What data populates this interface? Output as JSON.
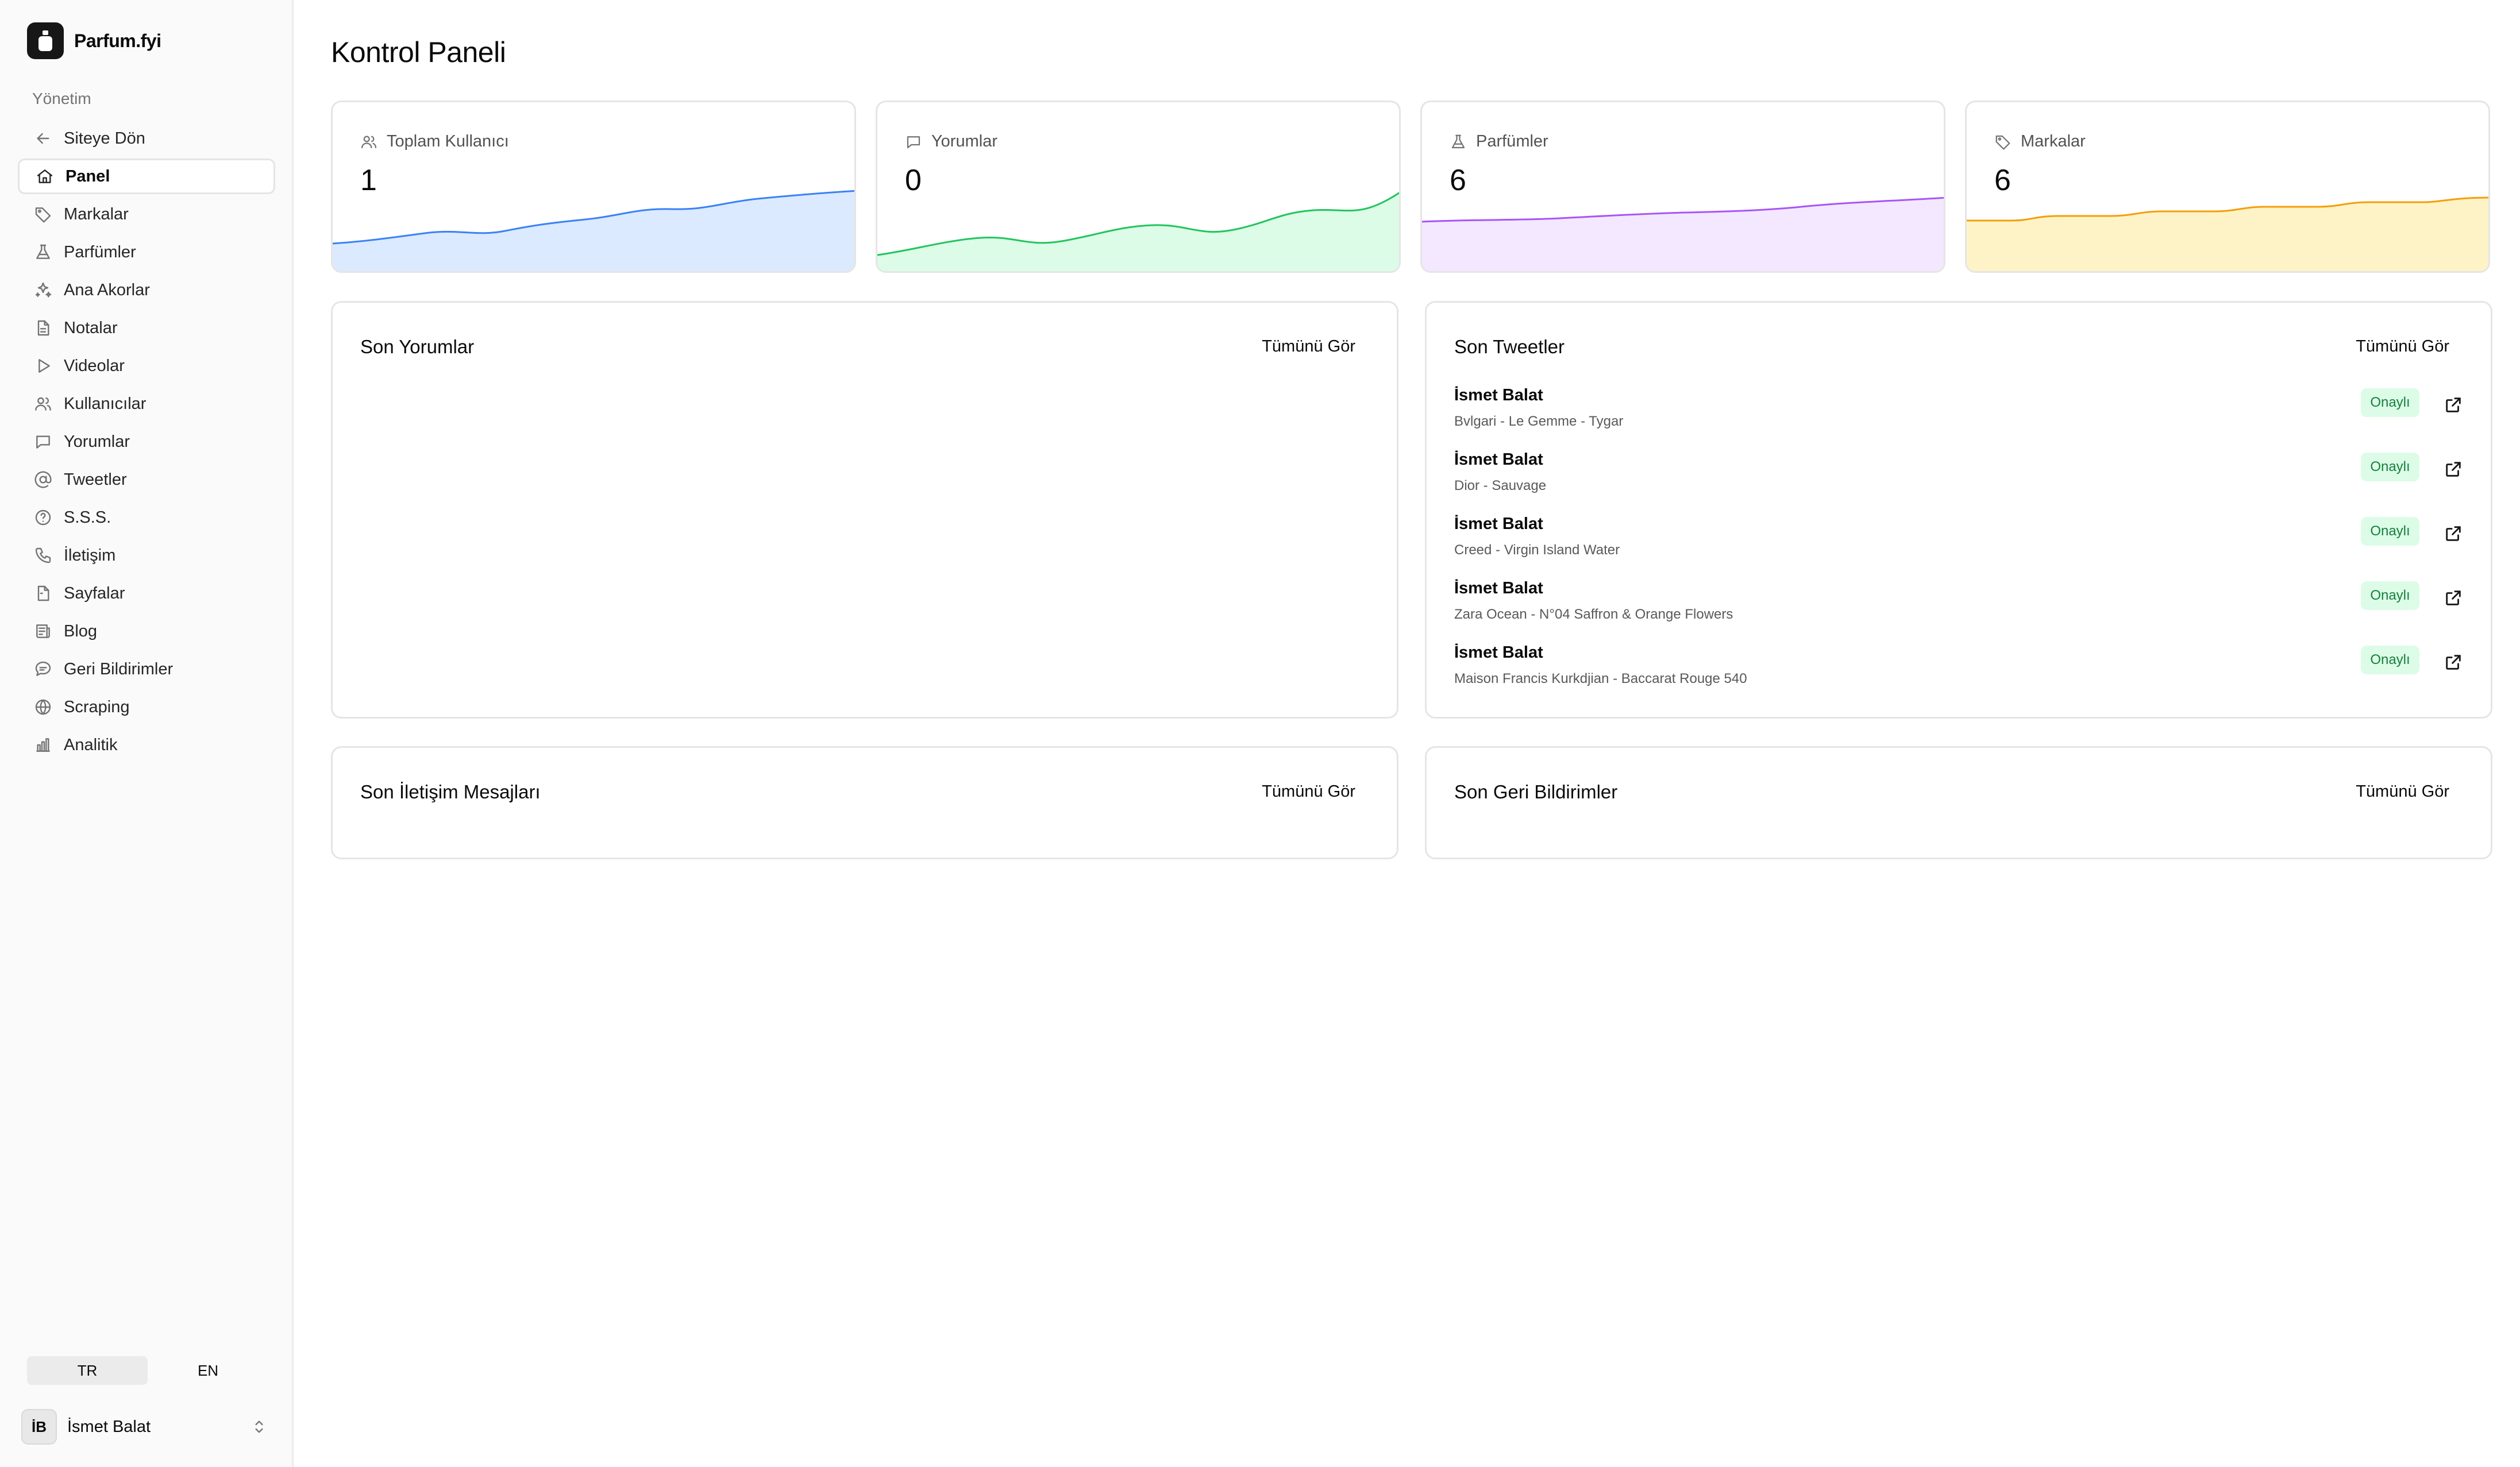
{
  "brand": {
    "name": "Parfum.fyi"
  },
  "sidebar": {
    "section_label": "Yönetim",
    "items": [
      {
        "label": "Siteye Dön",
        "icon": "arrow-left-icon"
      },
      {
        "label": "Panel",
        "icon": "home-icon",
        "active": true
      },
      {
        "label": "Markalar",
        "icon": "tag-icon"
      },
      {
        "label": "Parfümler",
        "icon": "flask-icon"
      },
      {
        "label": "Ana Akorlar",
        "icon": "sparkles-icon"
      },
      {
        "label": "Notalar",
        "icon": "document-icon"
      },
      {
        "label": "Videolar",
        "icon": "play-icon"
      },
      {
        "label": "Kullanıcılar",
        "icon": "users-icon"
      },
      {
        "label": "Yorumlar",
        "icon": "chat-icon"
      },
      {
        "label": "Tweetler",
        "icon": "at-icon"
      },
      {
        "label": "S.S.S.",
        "icon": "help-icon"
      },
      {
        "label": "İletişim",
        "icon": "phone-icon"
      },
      {
        "label": "Sayfalar",
        "icon": "file-icon"
      },
      {
        "label": "Blog",
        "icon": "newspaper-icon"
      },
      {
        "label": "Geri Bildirimler",
        "icon": "message-icon"
      },
      {
        "label": "Scraping",
        "icon": "globe-icon"
      },
      {
        "label": "Analitik",
        "icon": "bar-chart-icon"
      }
    ],
    "lang": {
      "tr": "TR",
      "en": "EN",
      "active": "TR"
    },
    "user": {
      "initials": "İB",
      "name": "İsmet Balat"
    }
  },
  "main": {
    "title": "Kontrol Paneli",
    "stats": [
      {
        "label": "Toplam Kullanıcı",
        "value": "1",
        "icon": "users-icon",
        "color": "#3b82f6",
        "fill": "#dbeafe"
      },
      {
        "label": "Yorumlar",
        "value": "0",
        "icon": "chat-icon",
        "color": "#22c55e",
        "fill": "#dcfce7"
      },
      {
        "label": "Parfümler",
        "value": "6",
        "icon": "flask-icon",
        "color": "#a855f7",
        "fill": "#f3e8ff"
      },
      {
        "label": "Markalar",
        "value": "6",
        "icon": "tag-icon",
        "color": "#f59e0b",
        "fill": "#fef3c7"
      }
    ],
    "recent_comments": {
      "title": "Son Yorumlar",
      "link": "Tümünü Gör"
    },
    "recent_tweets": {
      "title": "Son Tweetler",
      "link": "Tümünü Gör",
      "items": [
        {
          "name": "İsmet Balat",
          "subtitle": "Bvlgari - Le Gemme - Tygar",
          "status": "Onaylı"
        },
        {
          "name": "İsmet Balat",
          "subtitle": "Dior - Sauvage",
          "status": "Onaylı"
        },
        {
          "name": "İsmet Balat",
          "subtitle": "Creed - Virgin Island Water",
          "status": "Onaylı"
        },
        {
          "name": "İsmet Balat",
          "subtitle": "Zara Ocean - N°04 Saffron & Orange Flowers",
          "status": "Onaylı"
        },
        {
          "name": "İsmet Balat",
          "subtitle": "Maison Francis Kurkdjian - Baccarat Rouge 540",
          "status": "Onaylı"
        }
      ]
    },
    "recent_contacts": {
      "title": "Son İletişim Mesajları",
      "link": "Tümünü Gör"
    },
    "recent_feedback": {
      "title": "Son Geri Bildirimler",
      "link": "Tümünü Gör"
    }
  }
}
